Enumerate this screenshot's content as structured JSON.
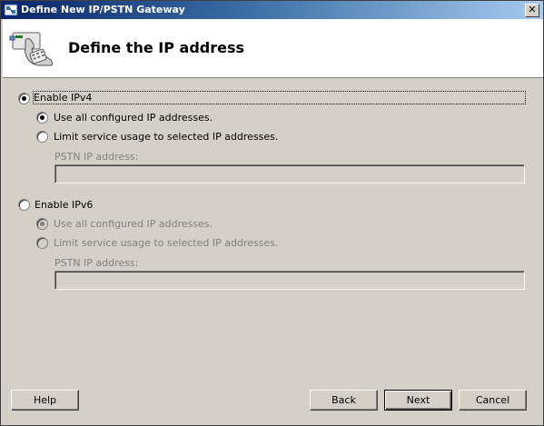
{
  "window": {
    "title": "Define New IP/PSTN Gateway",
    "close_glyph": "✕"
  },
  "banner": {
    "title": "Define the IP address",
    "icon": "phone-gateway-icon"
  },
  "ipv4": {
    "enable_label": "Enable IPv4",
    "enabled": true,
    "use_all_label": "Use all configured IP addresses.",
    "limit_label": "Limit service usage to selected IP addresses.",
    "pstn_label": "PSTN IP address:",
    "pstn_value": ""
  },
  "ipv6": {
    "enable_label": "Enable IPv6",
    "enabled": false,
    "use_all_label": "Use all configured IP addresses.",
    "limit_label": "Limit service usage to selected IP addresses.",
    "pstn_label": "PSTN IP address:",
    "pstn_value": ""
  },
  "buttons": {
    "help": "Help",
    "back": "Back",
    "next": "Next",
    "cancel": "Cancel"
  },
  "colors": {
    "titlebar_start": "#0a246a",
    "titlebar_end": "#a6caf0",
    "dialog_bg": "#d4d0c8",
    "disabled_text": "#808080"
  }
}
